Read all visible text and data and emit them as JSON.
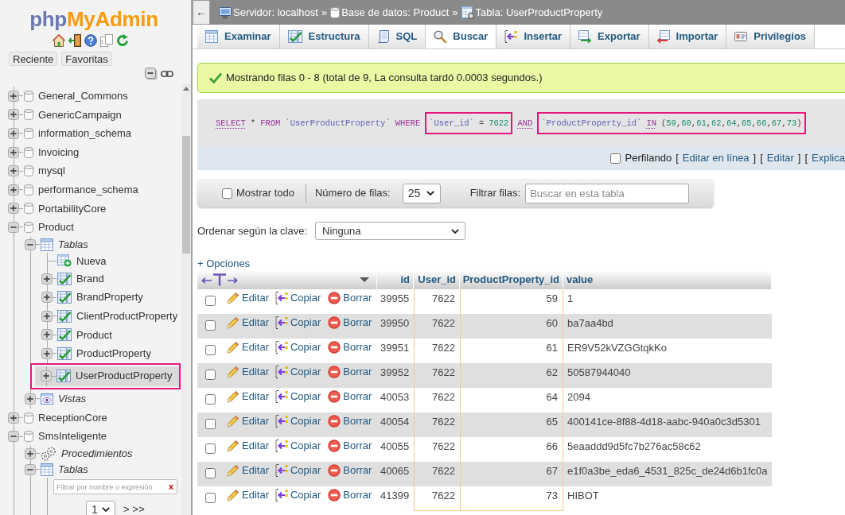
{
  "sidebar": {
    "logo": {
      "prefix": "php",
      "name": "MyAdmin"
    },
    "quick_links": [
      "Reciente",
      "Favoritas"
    ],
    "tree": [
      {
        "label": "General_Commons",
        "kind": "database",
        "expanded": false
      },
      {
        "label": "GenericCampaign",
        "kind": "database",
        "expanded": false
      },
      {
        "label": "information_schema",
        "kind": "database",
        "expanded": false
      },
      {
        "label": "Invoicing",
        "kind": "database",
        "expanded": false
      },
      {
        "label": "mysql",
        "kind": "database",
        "expanded": false
      },
      {
        "label": "performance_schema",
        "kind": "database",
        "expanded": false
      },
      {
        "label": "PortabilityCore",
        "kind": "database",
        "expanded": false
      },
      {
        "label": "Product",
        "kind": "database",
        "expanded": true,
        "children": [
          {
            "label": "Tablas",
            "kind": "group",
            "expanded": true,
            "children": [
              {
                "label": "Nueva",
                "kind": "new",
                "selected": false,
                "annotated": false
              },
              {
                "label": "Brand",
                "kind": "table",
                "expanded": false,
                "selected": false,
                "annotated": false
              },
              {
                "label": "BrandProperty",
                "kind": "table",
                "expanded": false,
                "selected": false,
                "annotated": false
              },
              {
                "label": "ClientProductProperty",
                "kind": "table",
                "expanded": false,
                "selected": false,
                "annotated": false
              },
              {
                "label": "Product",
                "kind": "table",
                "expanded": false,
                "selected": false,
                "annotated": false
              },
              {
                "label": "ProductProperty",
                "kind": "table",
                "expanded": false,
                "selected": false,
                "annotated": false
              },
              {
                "label": "UserProductProperty",
                "kind": "table",
                "expanded": false,
                "selected": true,
                "annotated": true
              }
            ]
          },
          {
            "label": "Vistas",
            "kind": "views",
            "expanded": false
          }
        ]
      },
      {
        "label": "ReceptionCore",
        "kind": "database",
        "expanded": false
      },
      {
        "label": "SmsInteligente",
        "kind": "database",
        "expanded": true,
        "children": [
          {
            "label": "Procedimientos",
            "kind": "procedures",
            "expanded": false
          },
          {
            "label": "Tablas",
            "kind": "group",
            "expanded": true,
            "children": [
              {
                "kind": "filter",
                "placeholder": "Filtrar por nombre o expresión",
                "clear": "x"
              },
              {
                "kind": "pager",
                "page": "1",
                "next": ">",
                "last": ">>"
              }
            ]
          }
        ]
      }
    ]
  },
  "breadcrumb": {
    "back": "←",
    "items": [
      {
        "label": "Servidor: localhost",
        "separator": "»"
      },
      {
        "label": "Base de datos: Product",
        "separator": "»"
      },
      {
        "label": "Tabla: UserProductProperty"
      }
    ]
  },
  "tabs": [
    {
      "label": "Examinar",
      "selected": false
    },
    {
      "label": "Estructura",
      "selected": false
    },
    {
      "label": "SQL",
      "selected": false
    },
    {
      "label": "Buscar",
      "selected": true
    },
    {
      "label": "Insertar",
      "selected": false
    },
    {
      "label": "Exportar",
      "selected": false
    },
    {
      "label": "Importar",
      "selected": false
    },
    {
      "label": "Privilegios",
      "selected": false
    }
  ],
  "message": "Mostrando filas 0 - 8 (total de 9, La consulta tardó 0.0003 segundos.)",
  "sql": {
    "segments": [
      {
        "highlighted": false,
        "tokens": [
          {
            "text": "SELECT",
            "kind": "keyword",
            "link": true
          },
          {
            "text": "*",
            "kind": "operator"
          },
          {
            "text": "FROM",
            "kind": "keyword",
            "link": false
          },
          {
            "text": "`UserProductProperty`",
            "kind": "identifier"
          },
          {
            "text": "WHERE",
            "kind": "keyword",
            "link": false
          }
        ]
      },
      {
        "highlighted": true,
        "tokens": [
          {
            "text": "`User_id`",
            "kind": "identifier"
          },
          {
            "text": "=",
            "kind": "operator"
          },
          {
            "text": "7622",
            "kind": "number"
          }
        ]
      },
      {
        "highlighted": false,
        "tokens": [
          {
            "text": "AND",
            "kind": "keyword",
            "link": true
          }
        ]
      },
      {
        "highlighted": true,
        "tokens": [
          {
            "text": "`ProductProperty_id`",
            "kind": "identifier"
          },
          {
            "text": "IN",
            "kind": "keyword",
            "link": true
          },
          {
            "text": "(59,60,61,62,64,65,66,67,73)",
            "kind": "list"
          }
        ]
      }
    ]
  },
  "profiling": {
    "checked": false,
    "label": "Perfilando",
    "links": [
      {
        "open": "[",
        "text": "Editar en línea",
        "close": "]"
      },
      {
        "open": "[",
        "text": "Editar",
        "close": "]"
      },
      {
        "open": "[",
        "text": "Explica"
      }
    ]
  },
  "navigation": {
    "show_all": {
      "checked": false,
      "label": "Mostrar todo"
    },
    "rows_label": "Número de filas:",
    "rows_value": "25",
    "filter_label": "Filtrar filas:",
    "filter_placeholder": "Buscar en esta tabla"
  },
  "sort": {
    "label": "Ordenar según la clave:",
    "value": "Ninguna"
  },
  "options_link": "+ Opciones",
  "table": {
    "columns": [
      {
        "label": "id",
        "kind": "number",
        "condition": false
      },
      {
        "label": "User_id",
        "kind": "number",
        "condition": true
      },
      {
        "label": "ProductProperty_id",
        "kind": "number",
        "condition": true
      },
      {
        "label": "value",
        "kind": "text",
        "condition": false
      }
    ],
    "rows": [
      {
        "selected": false,
        "actions": [
          "Editar",
          "Copiar",
          "Borrar"
        ],
        "cells": [
          "39955",
          "7622",
          "59",
          "1"
        ]
      },
      {
        "selected": false,
        "actions": [
          "Editar",
          "Copiar",
          "Borrar"
        ],
        "cells": [
          "39950",
          "7622",
          "60",
          "ba7aa4bd"
        ]
      },
      {
        "selected": false,
        "actions": [
          "Editar",
          "Copiar",
          "Borrar"
        ],
        "cells": [
          "39951",
          "7622",
          "61",
          "ER9V52kVZGGtqkKo"
        ]
      },
      {
        "selected": false,
        "actions": [
          "Editar",
          "Copiar",
          "Borrar"
        ],
        "cells": [
          "39952",
          "7622",
          "62",
          "50587944040"
        ]
      },
      {
        "selected": false,
        "actions": [
          "Editar",
          "Copiar",
          "Borrar"
        ],
        "cells": [
          "40053",
          "7622",
          "64",
          "2094"
        ]
      },
      {
        "selected": false,
        "actions": [
          "Editar",
          "Copiar",
          "Borrar"
        ],
        "cells": [
          "40054",
          "7622",
          "65",
          "400141ce-8f88-4d18-aabc-940a0c3d5301"
        ]
      },
      {
        "selected": false,
        "actions": [
          "Editar",
          "Copiar",
          "Borrar"
        ],
        "cells": [
          "40055",
          "7622",
          "66",
          "5eaaddd9d5fc7b276ac58c62"
        ]
      },
      {
        "selected": false,
        "actions": [
          "Editar",
          "Copiar",
          "Borrar"
        ],
        "cells": [
          "40065",
          "7622",
          "67",
          "e1f0a3be_eda6_4531_825c_de24d6b1fc0a"
        ]
      },
      {
        "selected": false,
        "actions": [
          "Editar",
          "Copiar",
          "Borrar"
        ],
        "cells": [
          "41399",
          "7622",
          "73",
          "HIBOT"
        ]
      }
    ]
  }
}
